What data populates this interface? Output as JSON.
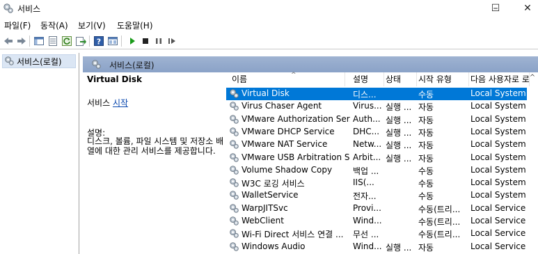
{
  "window": {
    "title": "서비스",
    "min_glyph": "–",
    "max_glyph": "☐",
    "close_glyph": "✕"
  },
  "menu": [
    "파일(F)",
    "동작(A)",
    "보기(V)",
    "도움말(H)"
  ],
  "tree": {
    "root_label": "서비스(로컬)"
  },
  "pane_header": "서비스(로컬)",
  "detail": {
    "service_name": "Virtual Disk",
    "start_prefix": "서비스 ",
    "start_link": "시작",
    "desc_label": "설명:",
    "desc_text": "디스크, 볼륨, 파일 시스템 및 저장소 배열에 대한 관리 서비스를 제공합니다."
  },
  "columns": [
    "이름",
    "설명",
    "상태",
    "시작 유형",
    "다음 사용자로 로"
  ],
  "sort_arrow": "^",
  "scroll_up": "^",
  "rows": [
    {
      "name": "Virtual Disk",
      "desc": "디스...",
      "status": "",
      "startup": "수동",
      "logon": "Local System",
      "selected": true
    },
    {
      "name": "Virus Chaser Agent",
      "desc": "Virus...",
      "status": "실행 ...",
      "startup": "자동",
      "logon": "Local System"
    },
    {
      "name": "VMware Authorization Ser...",
      "desc": "Auth...",
      "status": "실행 ...",
      "startup": "자동",
      "logon": "Local System"
    },
    {
      "name": "VMware DHCP Service",
      "desc": "DHC...",
      "status": "실행 ...",
      "startup": "자동",
      "logon": "Local System"
    },
    {
      "name": "VMware NAT Service",
      "desc": "Netw...",
      "status": "실행 ...",
      "startup": "자동",
      "logon": "Local System"
    },
    {
      "name": "VMware USB Arbitration S...",
      "desc": "Arbit...",
      "status": "실행 ...",
      "startup": "자동",
      "logon": "Local System"
    },
    {
      "name": "Volume Shadow Copy",
      "desc": "백업 ...",
      "status": "",
      "startup": "수동",
      "logon": "Local System"
    },
    {
      "name": "W3C 로깅 서비스",
      "desc": "IIS(...",
      "status": "",
      "startup": "수동",
      "logon": "Local System"
    },
    {
      "name": "WalletService",
      "desc": "전자...",
      "status": "",
      "startup": "수동",
      "logon": "Local System"
    },
    {
      "name": "WarpJITSvc",
      "desc": "Provi...",
      "status": "",
      "startup": "수동(트리...",
      "logon": "Local Service"
    },
    {
      "name": "WebClient",
      "desc": "Wind...",
      "status": "",
      "startup": "수동(트리...",
      "logon": "Local Service"
    },
    {
      "name": "Wi-Fi Direct 서비스 연결 ...",
      "desc": "무선 ...",
      "status": "",
      "startup": "수동(트리...",
      "logon": "Local Service"
    },
    {
      "name": "Windows Audio",
      "desc": "Wind...",
      "status": "실행 ...",
      "startup": "자동",
      "logon": "Local Service"
    }
  ],
  "toolbar_icons": [
    "back-arrow-icon",
    "forward-arrow-icon",
    "show-hide-tree-icon",
    "properties-icon",
    "refresh-icon",
    "export-list-icon",
    "help-icon",
    "console-view-icon",
    "start-service-icon",
    "stop-service-icon",
    "pause-service-icon",
    "restart-service-icon"
  ],
  "colors": {
    "selection": "#0078d7",
    "header_band": "#8aa2c7",
    "tree_select": "#dbe6f4",
    "link": "#0645ad",
    "play_green": "#1a9b1a"
  }
}
